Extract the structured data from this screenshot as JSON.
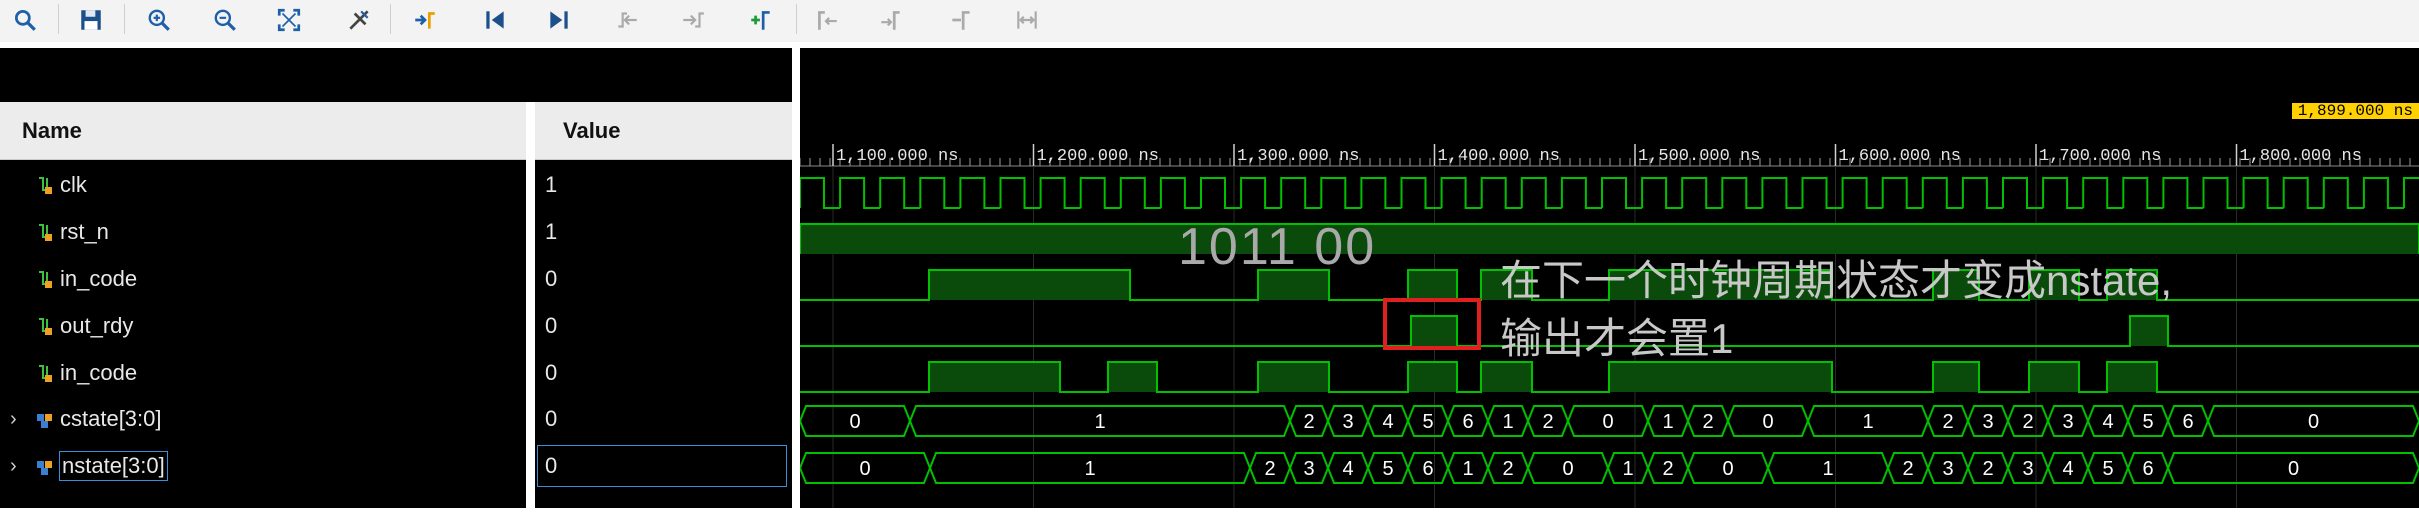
{
  "toolbar": {
    "buttons": [
      {
        "icon": "search-icon"
      },
      {
        "icon": "save-icon"
      },
      {
        "icon": "zoom-in-icon"
      },
      {
        "icon": "zoom-out-icon"
      },
      {
        "icon": "zoom-fit-icon"
      },
      {
        "icon": "cursor-tool-icon"
      },
      {
        "icon": "go-to-cursor-icon"
      },
      {
        "icon": "go-to-start-icon"
      },
      {
        "icon": "go-to-end-icon"
      },
      {
        "icon": "previous-transition-icon"
      },
      {
        "icon": "next-transition-icon"
      },
      {
        "icon": "add-marker-icon"
      },
      {
        "icon": "previous-marker-icon"
      },
      {
        "icon": "next-marker-icon"
      },
      {
        "icon": "swap-cursors-icon"
      },
      {
        "icon": "fit-marker-icon"
      }
    ]
  },
  "columns": {
    "name": "Name",
    "value": "Value"
  },
  "signals": [
    {
      "name": "clk",
      "value": "1",
      "expandable": false
    },
    {
      "name": "rst_n",
      "value": "1",
      "expandable": false
    },
    {
      "name": "in_code",
      "value": "0",
      "expandable": false
    },
    {
      "name": "out_rdy",
      "value": "0",
      "expandable": false
    },
    {
      "name": "in_code",
      "value": "0",
      "expandable": false
    },
    {
      "name": "cstate[3:0]",
      "value": "0",
      "expandable": true
    },
    {
      "name": "nstate[3:0]",
      "value": "0",
      "expandable": true
    }
  ],
  "ruler": {
    "labels": [
      "1,100.000 ns",
      "1,200.000 ns",
      "1,300.000 ns",
      "1,400.000 ns",
      "1,500.000 ns",
      "1,600.000 ns",
      "1,700.000 ns",
      "1,800.000 ns"
    ],
    "cursor": "1,899.000 ns"
  },
  "cstate_values": [
    "0",
    "1",
    "2",
    "3",
    "4",
    "5",
    "6",
    "1",
    "2",
    "0",
    "1",
    "2",
    "0",
    "1",
    "2",
    "3",
    "2",
    "3",
    "4",
    "5",
    "6",
    "0"
  ],
  "nstate_values": [
    "0",
    "1",
    "2",
    "3",
    "4",
    "5",
    "6",
    "1",
    "2",
    "0",
    "1",
    "2",
    "0",
    "1",
    "2",
    "3",
    "2",
    "3",
    "4",
    "5",
    "6",
    "0"
  ],
  "annotation": {
    "sequence": "1011 00",
    "line1": "在下一个时钟周期状态才变成nstate,",
    "line2": "输出才会置1"
  },
  "colors": {
    "wave": "#00c000",
    "wave_fill": "#0a4a0a",
    "bg": "#000000",
    "highlight": "#e02020"
  }
}
